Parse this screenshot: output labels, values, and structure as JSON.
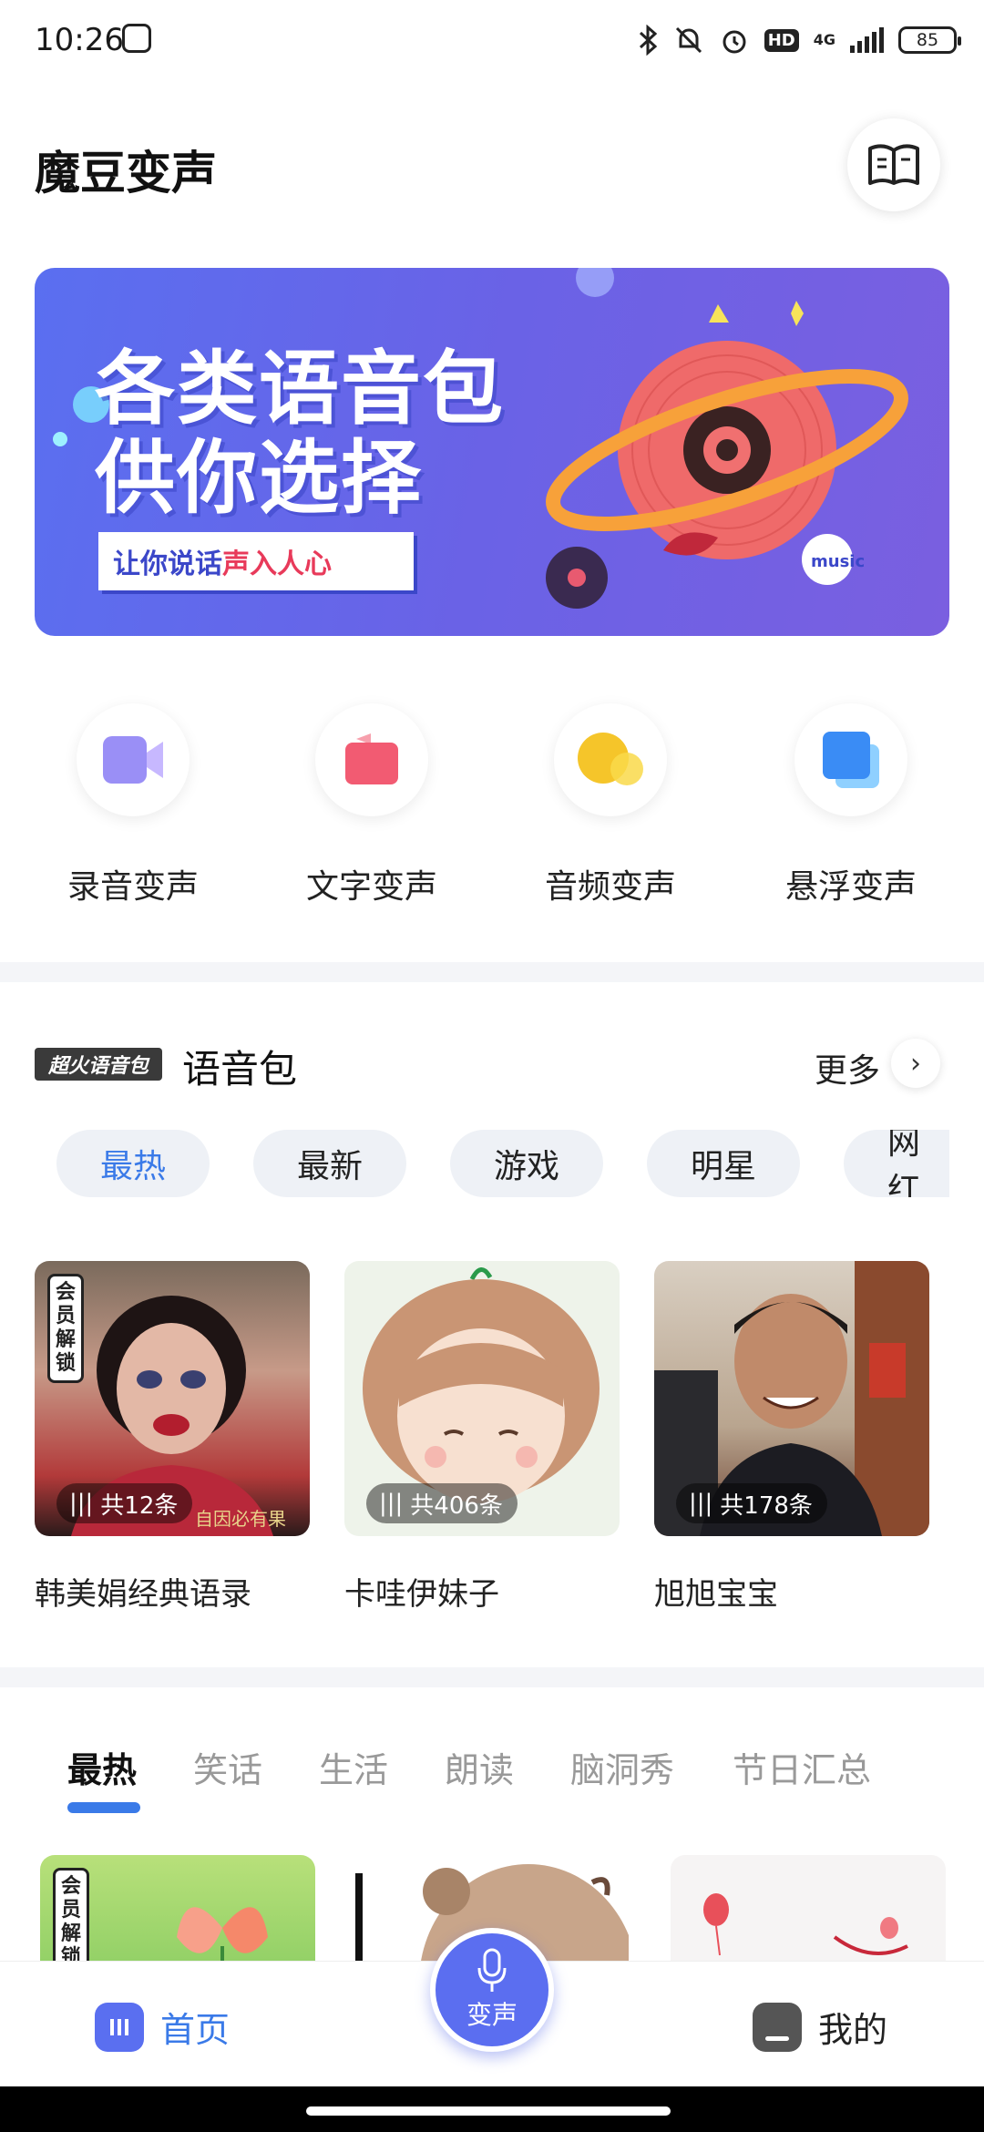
{
  "status": {
    "time": "10:26",
    "network": "4G",
    "hd": "HD",
    "battery": "85"
  },
  "app": {
    "title": "魔豆变声"
  },
  "banner": {
    "line1": "各类语音包",
    "line2": "供你选择",
    "tag_a": "让你说话",
    "tag_b": "声入人心",
    "music_text": "music"
  },
  "features": [
    {
      "label": "录音变声",
      "icon": "video-camera-icon",
      "color": "#8f84f5"
    },
    {
      "label": "文字变声",
      "icon": "text-card-icon",
      "color": "#f25b72"
    },
    {
      "label": "音频变声",
      "icon": "audio-bubble-icon",
      "color": "#f5c52a"
    },
    {
      "label": "悬浮变声",
      "icon": "float-window-icon",
      "color": "#3a8cf5"
    }
  ],
  "voice_pack": {
    "badge": "超火语音包",
    "title": "语音包",
    "more": "更多",
    "chips": [
      "最热",
      "最新",
      "游戏",
      "明星",
      "网红"
    ],
    "cards": [
      {
        "name": "韩美娟经典语录",
        "count": "共12条",
        "vip": [
          "会",
          "员",
          "解",
          "锁"
        ],
        "caption": "自因必有果"
      },
      {
        "name": "卡哇伊妹子",
        "count": "共406条"
      },
      {
        "name": "旭旭宝宝",
        "count": "共178条"
      }
    ]
  },
  "tabs": [
    "最热",
    "笑话",
    "生活",
    "朗读",
    "脑洞秀",
    "节日汇总"
  ],
  "tiles": {
    "vip": [
      "会",
      "员",
      "解",
      "锁"
    ]
  },
  "nav": {
    "home": "首页",
    "voice": "变声",
    "mine": "我的"
  },
  "colors": {
    "accent": "#3a7ae8",
    "banner": "#5a6ff0",
    "fab": "#5b6ef0"
  }
}
